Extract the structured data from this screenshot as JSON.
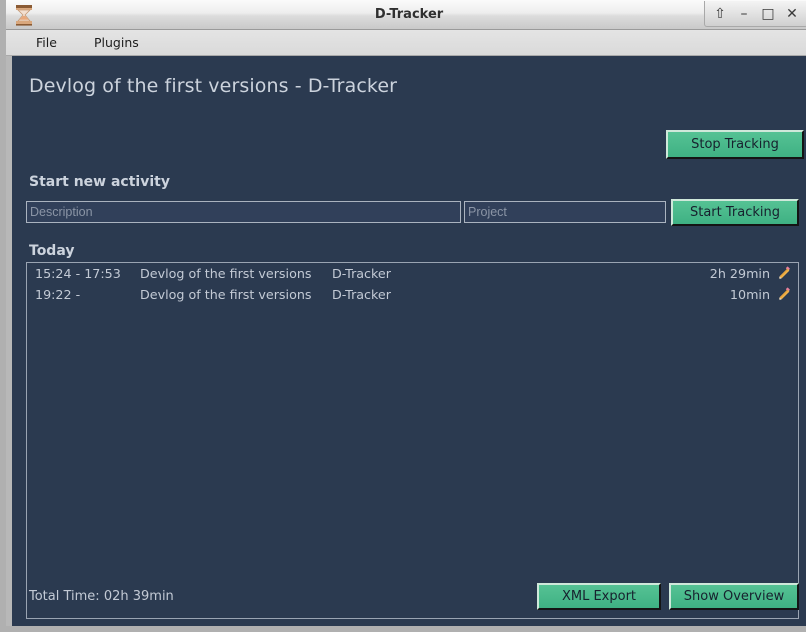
{
  "window": {
    "title": "D-Tracker",
    "icon": "hourglass-icon",
    "controls": [
      {
        "name": "shade-button",
        "glyph": "⇧"
      },
      {
        "name": "minimize-button",
        "glyph": "–"
      },
      {
        "name": "maximize-button",
        "glyph": "□"
      },
      {
        "name": "close-button",
        "glyph": "✕"
      }
    ]
  },
  "menubar": {
    "file": "File",
    "plugins": "Plugins"
  },
  "header": {
    "title": "Devlog of the first versions - D-Tracker",
    "stop_tracking_label": "Stop Tracking"
  },
  "start_activity": {
    "section_label": "Start new activity",
    "description_placeholder": "Description",
    "description_value": "",
    "project_placeholder": "Project",
    "project_value": "",
    "start_tracking_label": "Start Tracking"
  },
  "today": {
    "section_label": "Today",
    "entries": [
      {
        "time": "15:24 - 17:53",
        "description": "Devlog of the first versions",
        "project": "D-Tracker",
        "duration": "2h 29min",
        "edit_icon": "pencil-icon"
      },
      {
        "time": "19:22 -",
        "description": "Devlog of the first versions",
        "project": "D-Tracker",
        "duration": "10min",
        "edit_icon": "pencil-icon"
      }
    ]
  },
  "footer": {
    "total_time": "Total Time: 02h 39min",
    "xml_export_label": "XML Export",
    "show_overview_label": "Show Overview"
  },
  "colors": {
    "content_bg": "#2b3a50",
    "accent_green": "#43b687",
    "text_primary": "#ccd3dd",
    "text_muted": "#8b95a6",
    "chrome_gray": "#dadada",
    "pencil_body": "#e8a33d",
    "pencil_eraser": "#e87f9e"
  }
}
